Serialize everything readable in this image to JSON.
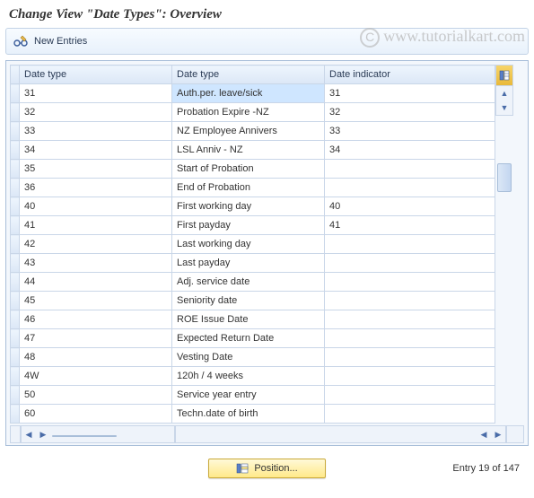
{
  "title": "Change View \"Date Types\": Overview",
  "toolbar": {
    "new_entries": "New Entries"
  },
  "watermark": "www.tutorialkart.com",
  "columns": {
    "c1": "Date type",
    "c2": "Date type",
    "c3": "Date indicator"
  },
  "rows": [
    {
      "c1": "31",
      "c2": "Auth.per. leave/sick",
      "c3": "31",
      "selected": true
    },
    {
      "c1": "32",
      "c2": "Probation Expire -NZ",
      "c3": "32"
    },
    {
      "c1": "33",
      "c2": "NZ Employee Annivers",
      "c3": "33"
    },
    {
      "c1": "34",
      "c2": "LSL Anniv - NZ",
      "c3": "34"
    },
    {
      "c1": "35",
      "c2": "Start of Probation",
      "c3": ""
    },
    {
      "c1": "36",
      "c2": "End of Probation",
      "c3": ""
    },
    {
      "c1": "40",
      "c2": "First working day",
      "c3": "40"
    },
    {
      "c1": "41",
      "c2": "First payday",
      "c3": "41"
    },
    {
      "c1": "42",
      "c2": "Last working day",
      "c3": ""
    },
    {
      "c1": "43",
      "c2": "Last payday",
      "c3": ""
    },
    {
      "c1": "44",
      "c2": "Adj. service date",
      "c3": ""
    },
    {
      "c1": "45",
      "c2": "Seniority date",
      "c3": ""
    },
    {
      "c1": "46",
      "c2": "ROE Issue Date",
      "c3": ""
    },
    {
      "c1": "47",
      "c2": "Expected Return Date",
      "c3": ""
    },
    {
      "c1": "48",
      "c2": "Vesting Date",
      "c3": ""
    },
    {
      "c1": "4W",
      "c2": "120h / 4 weeks",
      "c3": ""
    },
    {
      "c1": "50",
      "c2": "Service year entry",
      "c3": ""
    },
    {
      "c1": "60",
      "c2": "Techn.date of birth",
      "c3": ""
    }
  ],
  "footer": {
    "position_label": "Position...",
    "entry_label": "Entry 19 of 147"
  }
}
